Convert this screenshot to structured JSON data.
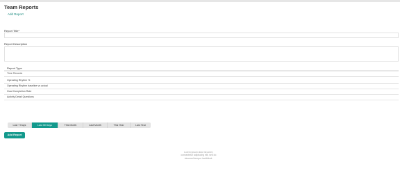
{
  "header": {
    "title": "Team Reports",
    "add_link": "Add Report"
  },
  "form": {
    "title_label": "Report Title*",
    "title_value": "",
    "description_label": "Report Description",
    "description_value": "",
    "type_label": "Report Type",
    "types": [
      "Time Records",
      "Operating Rhythm %",
      "Operating Rhythm baseline vs actual",
      "Goal Completion Rate",
      "Activity Detail Questions"
    ]
  },
  "date_range": {
    "tabs": [
      "Last 7 Days",
      "Last 30 Days",
      "This Month",
      "Last Month",
      "This Year",
      "Last Year"
    ],
    "selected": "Last 30 Days"
  },
  "actions": {
    "add_report_button": "Add Report"
  },
  "empty_state": {
    "message": "Lorem ipsum dolor sit amet, consectetur adipiscing elit, sed do eiusmod tempor incididunt."
  },
  "colors": {
    "accent": "#12998c",
    "link": "#1a8a7f"
  }
}
